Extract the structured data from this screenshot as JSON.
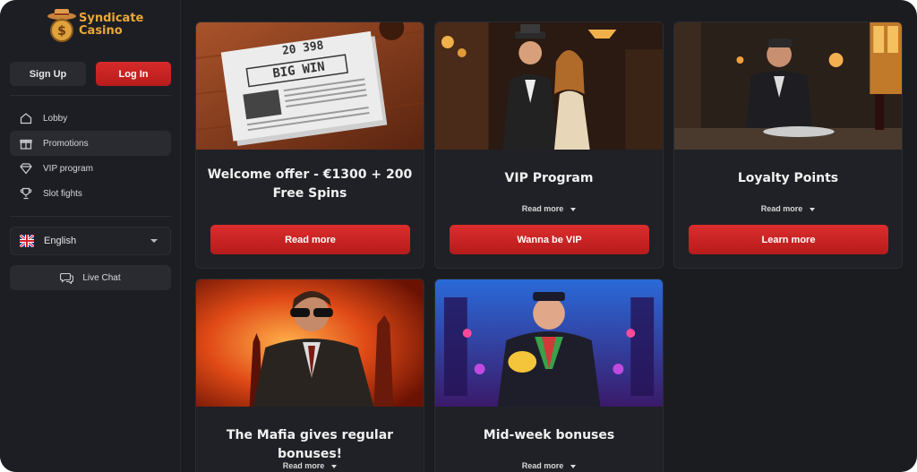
{
  "brand": {
    "line1": "Syndicate",
    "line2": "Casino",
    "accent": "#e8a83b"
  },
  "auth": {
    "signup": "Sign Up",
    "login": "Log In"
  },
  "nav": [
    {
      "label": "Lobby",
      "icon": "home-icon"
    },
    {
      "label": "Promotions",
      "icon": "gift-icon",
      "active": true
    },
    {
      "label": "VIP program",
      "icon": "diamond-icon"
    },
    {
      "label": "Slot fights",
      "icon": "trophy-icon"
    }
  ],
  "language": {
    "selected": "English",
    "icon": "uk-flag-icon"
  },
  "chat": {
    "label": "Live Chat",
    "icon": "chat-icon"
  },
  "cards": [
    {
      "title": "Welcome offer - €1300 + 200 Free Spins",
      "button": "Read more",
      "image_text_line1": "20 398",
      "image_text_line2": "BIG WIN"
    },
    {
      "title": "VIP Program",
      "readmore": "Read more",
      "button": "Wanna be VIP"
    },
    {
      "title": "Loyalty Points",
      "readmore": "Read more",
      "button": "Learn more"
    },
    {
      "title": "The Mafia gives regular bonuses!",
      "readmore": "Read more"
    },
    {
      "title": "Mid-week bonuses",
      "readmore": "Read more"
    }
  ],
  "colors": {
    "primary_red": "#d72a2a",
    "background": "#1b1c20",
    "card": "#202126"
  }
}
